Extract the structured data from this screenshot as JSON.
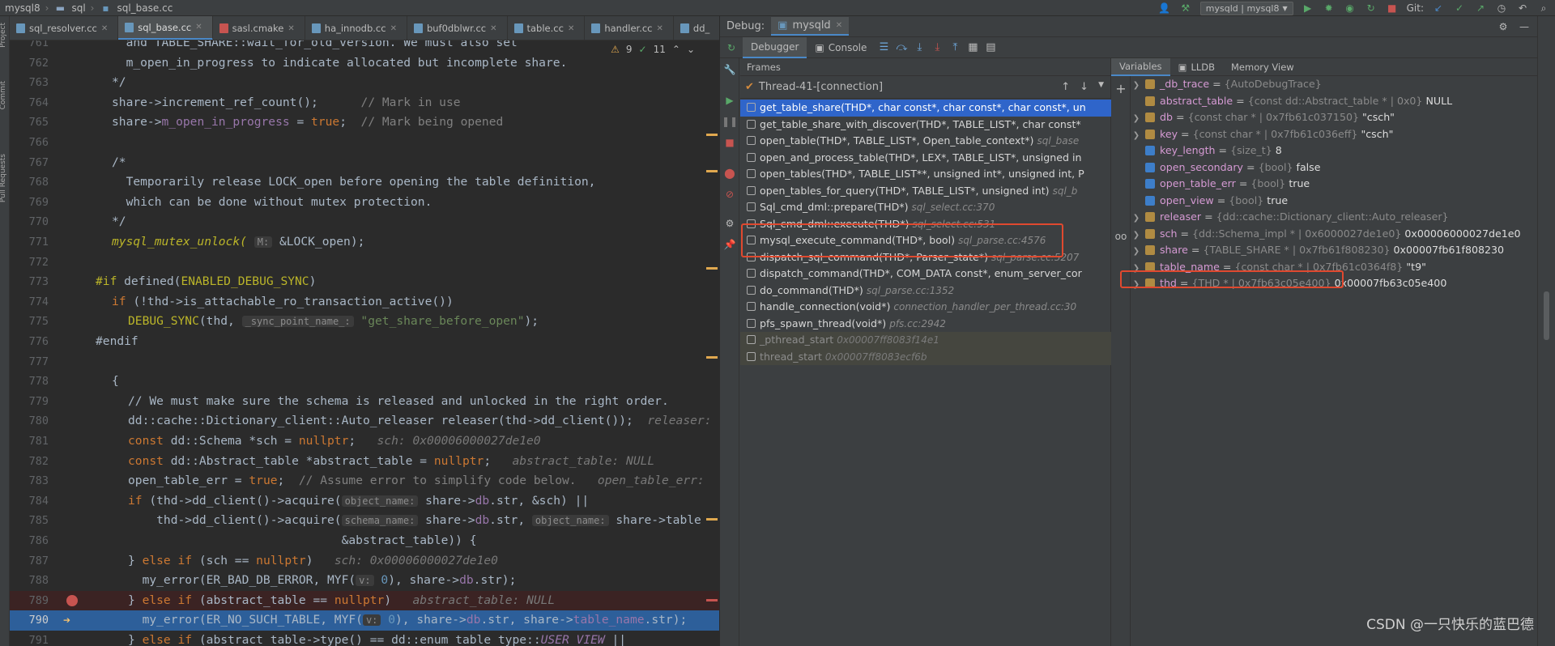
{
  "titlebar": {
    "crumbs": [
      "mysql8",
      "sql",
      "sql_base.cc"
    ],
    "run_config": "mysqld | mysql8",
    "git_label": "Git:"
  },
  "leftstrip": {
    "labels": [
      "Project",
      "Commit",
      "Pull Requests"
    ]
  },
  "editor": {
    "tabs": [
      {
        "label": "sql_resolver.cc",
        "active": false
      },
      {
        "label": "sql_base.cc",
        "active": true
      },
      {
        "label": "sasl.cmake",
        "active": false
      },
      {
        "label": "ha_innodb.cc",
        "active": false
      },
      {
        "label": "buf0dblwr.cc",
        "active": false
      },
      {
        "label": "table.cc",
        "active": false
      },
      {
        "label": "handler.cc",
        "active": false
      },
      {
        "label": "dd_",
        "active": false
      }
    ],
    "warnings": "9",
    "checks": "11"
  },
  "code": {
    "l761": {
      "n": "761",
      "t": "  and TABLE_SHARE::wait_for_old_version. We must also set"
    },
    "l762": {
      "n": "762",
      "t": "  m_open_in_progress to indicate allocated but incomplete share."
    },
    "l763": {
      "n": "763",
      "t": "*/"
    },
    "l764": {
      "n": "764",
      "a": "share->increment_ref_count();",
      "c": "      // Mark in use"
    },
    "l765": {
      "n": "765",
      "a": "share->",
      "b": "m_open_in_progress",
      "d": " = ",
      "e": "true",
      "f": ";",
      "c": "  // Mark being opened"
    },
    "l766": {
      "n": "766"
    },
    "l767": {
      "n": "767",
      "t": "/*"
    },
    "l768": {
      "n": "768",
      "t": "  Temporarily release LOCK_open before opening the table definition,"
    },
    "l769": {
      "n": "769",
      "t": "  which can be done without mutex protection."
    },
    "l770": {
      "n": "770",
      "t": "*/"
    },
    "l771": {
      "n": "771",
      "a": "mysql_mutex_unlock(",
      "h": "M:",
      "b": " &LOCK_open);"
    },
    "l772": {
      "n": "772"
    },
    "l773": {
      "n": "773",
      "a": "#if",
      "b": " defined(",
      "m": "ENABLED_DEBUG_SYNC",
      "d": ")"
    },
    "l774": {
      "n": "774",
      "a": "if",
      "b": " (!thd->is_attachable_ro_transaction_active())"
    },
    "l775": {
      "n": "775",
      "a": "DEBUG_SYNC",
      "b": "(thd, ",
      "h": "_sync_point_name_:",
      "s": " \"get_share_before_open\"",
      "d": ");"
    },
    "l776": {
      "n": "776",
      "a": "#endif"
    },
    "l777": {
      "n": "777"
    },
    "l778": {
      "n": "778",
      "t": "{"
    },
    "l779": {
      "n": "779",
      "t": "// We must make sure the schema is released and unlocked in the right order."
    },
    "l780": {
      "n": "780",
      "a": "dd::cache::Dictionary_client::Auto_releaser releaser(thd->dd_client());",
      "i": "  releaser:"
    },
    "l781": {
      "n": "781",
      "a": "const",
      "b": " dd::Schema *sch = ",
      "e": "nullptr",
      "d": ";",
      "i": "   sch: 0x00006000027de1e0"
    },
    "l782": {
      "n": "782",
      "a": "const",
      "b": " dd::Abstract_table *abstract_table = ",
      "e": "nullptr",
      "d": ";",
      "i": "   abstract_table: NULL"
    },
    "l783": {
      "n": "783",
      "a": "open_table_err = ",
      "e": "true",
      "d": ";",
      "c": "  // Assume error to simplify code below.",
      "i": "   open_table_err:"
    },
    "l784": {
      "n": "784",
      "a": "if",
      "b": " (thd->dd_client()->acquire(",
      "h": "object_name:",
      "d": " share->",
      "f": "db",
      "g": ".str, &sch) ||"
    },
    "l785": {
      "n": "785",
      "a": "    thd->dd_client()->acquire(",
      "h": "schema_name:",
      "b": " share->",
      "f": "db",
      "g": ".str, ",
      "h2": "object_name:",
      "d": " share->table"
    },
    "l786": {
      "n": "786",
      "t": "                              &abstract_table)) {"
    },
    "l787": {
      "n": "787",
      "a": "} ",
      "b": "else if",
      "d": " (sch == ",
      "e": "nullptr",
      "g": ")",
      "i": "   sch: 0x00006000027de1e0"
    },
    "l788": {
      "n": "788",
      "a": "  my_error(ER_BAD_DB_ERROR, MYF(",
      "h": "v:",
      "m": " 0",
      "d": "), share->",
      "f": "db",
      "g": ".str);"
    },
    "l789": {
      "n": "789",
      "a": "} ",
      "b": "else if",
      "d": " (abstract_table == ",
      "e": "nullptr",
      "g": ")",
      "i": "   abstract_table: NULL"
    },
    "l790": {
      "n": "790",
      "a": "  my_error(ER_NO_SUCH_TABLE, MYF(",
      "h": "v:",
      "m": " 0",
      "d": "), share->",
      "f": "db",
      "g": ".str, share->",
      "f2": "table_name",
      "g2": ".str);"
    },
    "l791": {
      "n": "791",
      "a": "} ",
      "b": "else if",
      "d": " (abstract_table->type() == dd::enum_table_type::",
      "f": "USER_VIEW",
      "g": " ||"
    }
  },
  "debug": {
    "label": "Debug:",
    "session": "mysqld",
    "tabs": {
      "debugger": "Debugger",
      "console": "Console"
    },
    "frames_title": "Frames",
    "thread": "Thread-41-[connection]",
    "frames": [
      {
        "fn": "get_table_share(THD*, char const*, char const*, char const*, un",
        "loc": ""
      },
      {
        "fn": "get_table_share_with_discover(THD*, TABLE_LIST*, char const*",
        "loc": ""
      },
      {
        "fn": "open_table(THD*, TABLE_LIST*, Open_table_context*) ",
        "loc": "sql_base"
      },
      {
        "fn": "open_and_process_table(THD*, LEX*, TABLE_LIST*, unsigned in",
        "loc": ""
      },
      {
        "fn": "open_tables(THD*, TABLE_LIST**, unsigned int*, unsigned int, P",
        "loc": ""
      },
      {
        "fn": "open_tables_for_query(THD*, TABLE_LIST*, unsigned int) ",
        "loc": "sql_b"
      },
      {
        "fn": "Sql_cmd_dml::prepare(THD*) ",
        "loc": "sql_select.cc:370"
      },
      {
        "fn": "Sql_cmd_dml::execute(THD*) ",
        "loc": "sql_select.cc:531"
      },
      {
        "fn": "mysql_execute_command(THD*, bool) ",
        "loc": "sql_parse.cc:4576"
      },
      {
        "fn": "dispatch_sql_command(THD*, Parser_state*) ",
        "loc": "sql_parse.cc:5207"
      },
      {
        "fn": "dispatch_command(THD*, COM_DATA const*, enum_server_cor",
        "loc": ""
      },
      {
        "fn": "do_command(THD*) ",
        "loc": "sql_parse.cc:1352"
      },
      {
        "fn": "handle_connection(void*) ",
        "loc": "connection_handler_per_thread.cc:30"
      },
      {
        "fn": "pfs_spawn_thread(void*) ",
        "loc": "pfs.cc:2942"
      },
      {
        "fn": "_pthread_start ",
        "loc": "0x00007ff8083f14e1"
      },
      {
        "fn": "thread_start ",
        "loc": "0x00007ff8083ecf6b"
      }
    ],
    "vars_tabs": {
      "variables": "Variables",
      "lldb": "LLDB",
      "memory": "Memory View"
    },
    "variables": [
      {
        "name": "_db_trace",
        "type": "{AutoDebugTrace}",
        "value": "",
        "expand": true,
        "icon": "obj"
      },
      {
        "name": "abstract_table",
        "type": "{const dd::Abstract_table * | 0x0}",
        "value": "NULL",
        "expand": false,
        "icon": "obj"
      },
      {
        "name": "db",
        "type": "{const char * | 0x7fb61c037150}",
        "value": "\"csch\"",
        "expand": true,
        "icon": "obj"
      },
      {
        "name": "key",
        "type": "{const char * | 0x7fb61c036eff}",
        "value": "\"csch\"",
        "expand": true,
        "icon": "obj"
      },
      {
        "name": "key_length",
        "type": "{size_t}",
        "value": "8",
        "expand": false,
        "icon": "prim"
      },
      {
        "name": "open_secondary",
        "type": "{bool}",
        "value": "false",
        "expand": false,
        "icon": "prim"
      },
      {
        "name": "open_table_err",
        "type": "{bool}",
        "value": "true",
        "expand": false,
        "icon": "prim"
      },
      {
        "name": "open_view",
        "type": "{bool}",
        "value": "true",
        "expand": false,
        "icon": "prim"
      },
      {
        "name": "releaser",
        "type": "{dd::cache::Dictionary_client::Auto_releaser}",
        "value": "",
        "expand": true,
        "icon": "obj"
      },
      {
        "name": "sch",
        "type": "{dd::Schema_impl * | 0x6000027de1e0}",
        "value": "0x00006000027de1e0",
        "expand": true,
        "icon": "obj"
      },
      {
        "name": "share",
        "type": "{TABLE_SHARE * | 0x7fb61f808230}",
        "value": "0x00007fb61f808230",
        "expand": true,
        "icon": "obj"
      },
      {
        "name": "table_name",
        "type": "{const char * | 0x7fb61c0364f8}",
        "value": "\"t9\"",
        "expand": true,
        "icon": "obj"
      },
      {
        "name": "thd",
        "type": "{THD * | 0x7fb63c05e400}",
        "value": "0x00007fb63c05e400",
        "expand": true,
        "icon": "obj"
      }
    ]
  },
  "watermark": "CSDN @一只快乐的蓝巴德"
}
